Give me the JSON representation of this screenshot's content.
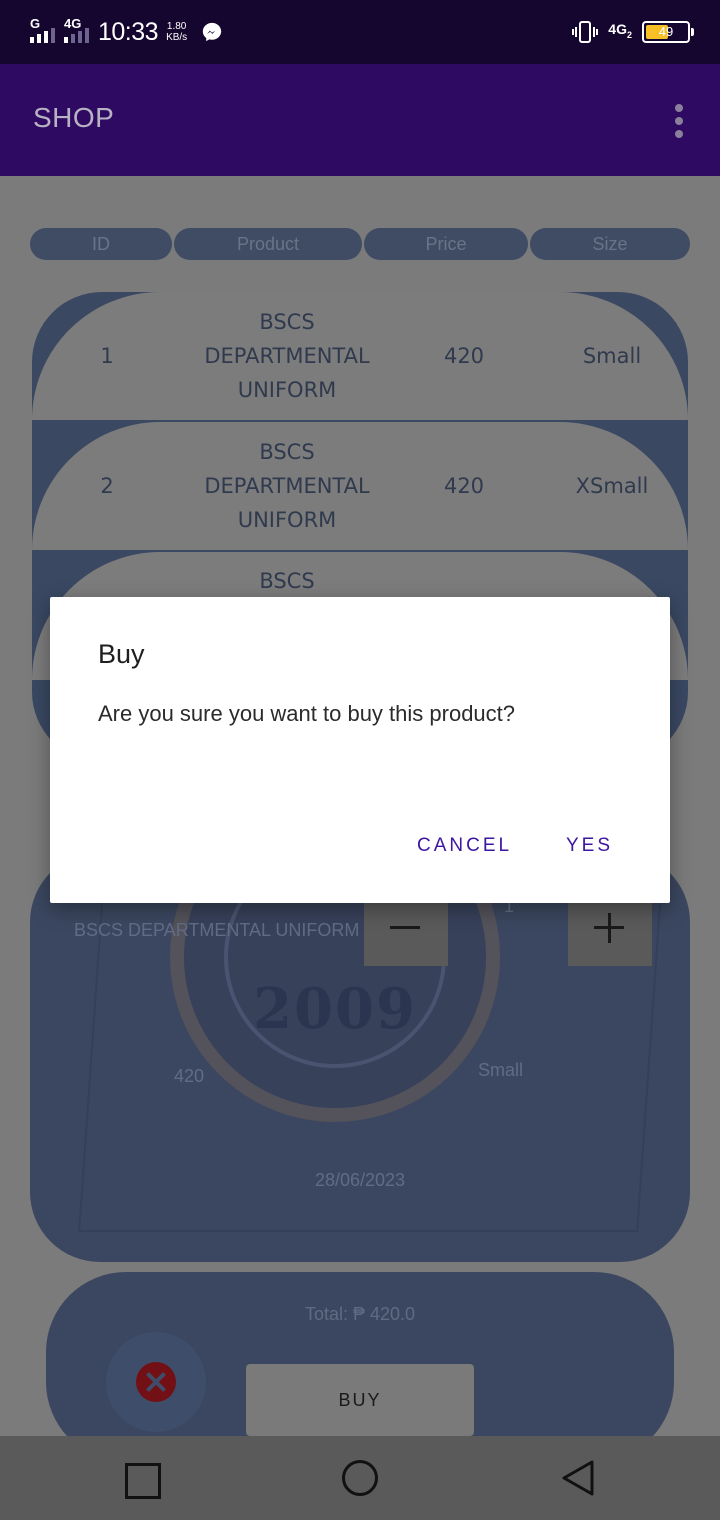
{
  "status_bar": {
    "net_left_1": "G",
    "net_left_2": "4G",
    "time": "10:33",
    "speed_value": "1.80",
    "speed_unit": "KB/s",
    "messenger_icon": "messenger-icon",
    "net_right": "4G",
    "net_right_sub": "2",
    "battery": "49"
  },
  "app_bar": {
    "title": "SHOP",
    "menu_icon": "more-vert-icon"
  },
  "table": {
    "headers": [
      "ID",
      "Product",
      "Price",
      "Size"
    ],
    "rows": [
      {
        "id": "1",
        "product_line1": "BSCS",
        "product_line2": "DEPARTMENTAL",
        "product_line3": "UNIFORM",
        "price": "420",
        "size": "Small"
      },
      {
        "id": "2",
        "product_line1": "BSCS",
        "product_line2": "DEPARTMENTAL",
        "product_line3": "UNIFORM",
        "price": "420",
        "size": "XSmall"
      },
      {
        "id": "",
        "product_line1": "BSCS",
        "product_line2": "",
        "product_line3": "",
        "price": "",
        "size": ""
      }
    ]
  },
  "detail": {
    "product_name": "BSCS DEPARTMENTAL UNIFORM",
    "quantity": "1",
    "price": "420",
    "size": "Small",
    "date": "28/06/2023",
    "emblem_text": "2009"
  },
  "checkout": {
    "total": "Total: ₱ 420.0",
    "buy_label": "BUY",
    "close_icon": "close-icon"
  },
  "dialog": {
    "title": "Buy",
    "message": "Are you sure you want to buy this product?",
    "cancel_label": "CANCEL",
    "yes_label": "YES"
  },
  "colors": {
    "app_bar": "#2e0a63",
    "status_bar": "#14062e",
    "dialog_button": "#3d16a0",
    "close_button": "#721015"
  }
}
